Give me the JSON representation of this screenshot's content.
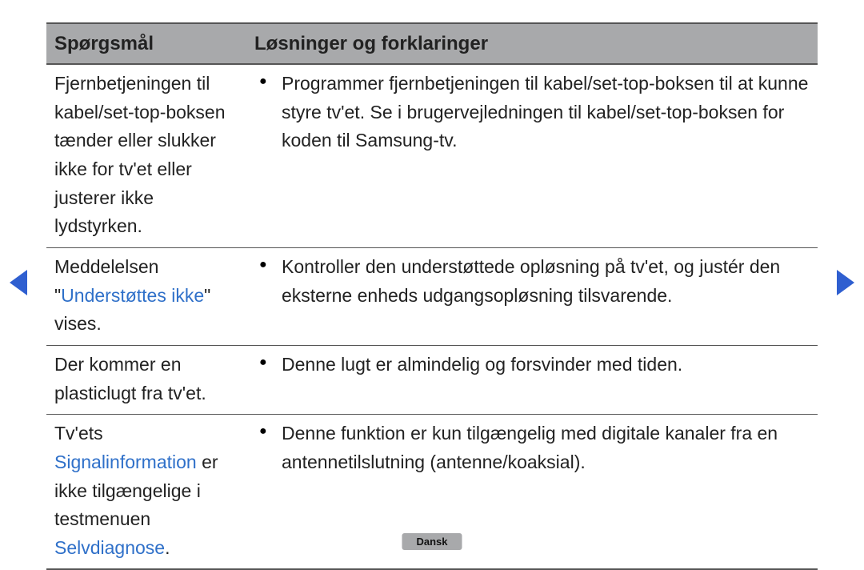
{
  "table": {
    "headers": {
      "question": "Spørgsmål",
      "solution": "Løsninger og forklaringer"
    },
    "rows": [
      {
        "question_parts": [
          {
            "text": "Fjernbetjeningen til kabel/set-top-boksen tænder eller slukker ikke for tv'et eller justerer ikke lydstyrken.",
            "blue": false
          }
        ],
        "solutions": [
          "Programmer fjernbetjeningen til kabel/set-top-boksen til at kunne styre tv'et. Se i brugervejledningen til kabel/set-top-boksen for koden til Samsung-tv."
        ]
      },
      {
        "question_parts": [
          {
            "text": "Meddelelsen \"",
            "blue": false
          },
          {
            "text": "Understøttes ikke",
            "blue": true
          },
          {
            "text": "\" vises.",
            "blue": false
          }
        ],
        "solutions": [
          "Kontroller den understøttede opløsning på tv'et, og justér den eksterne enheds udgangsopløsning tilsvarende."
        ]
      },
      {
        "question_parts": [
          {
            "text": "Der kommer en plasticlugt fra tv'et.",
            "blue": false
          }
        ],
        "solutions": [
          "Denne lugt er almindelig og forsvinder med tiden."
        ]
      },
      {
        "question_parts": [
          {
            "text": "Tv'ets ",
            "blue": false
          },
          {
            "text": "Signalinformation",
            "blue": true
          },
          {
            "text": " er ikke tilgængelige i testmenuen ",
            "blue": false
          },
          {
            "text": "Selvdiagnose",
            "blue": true
          },
          {
            "text": ".",
            "blue": false
          }
        ],
        "solutions": [
          "Denne funktion er kun tilgængelig med digitale kanaler fra en antennetilslutning (antenne/koaksial)."
        ]
      }
    ]
  },
  "language_badge": "Dansk"
}
